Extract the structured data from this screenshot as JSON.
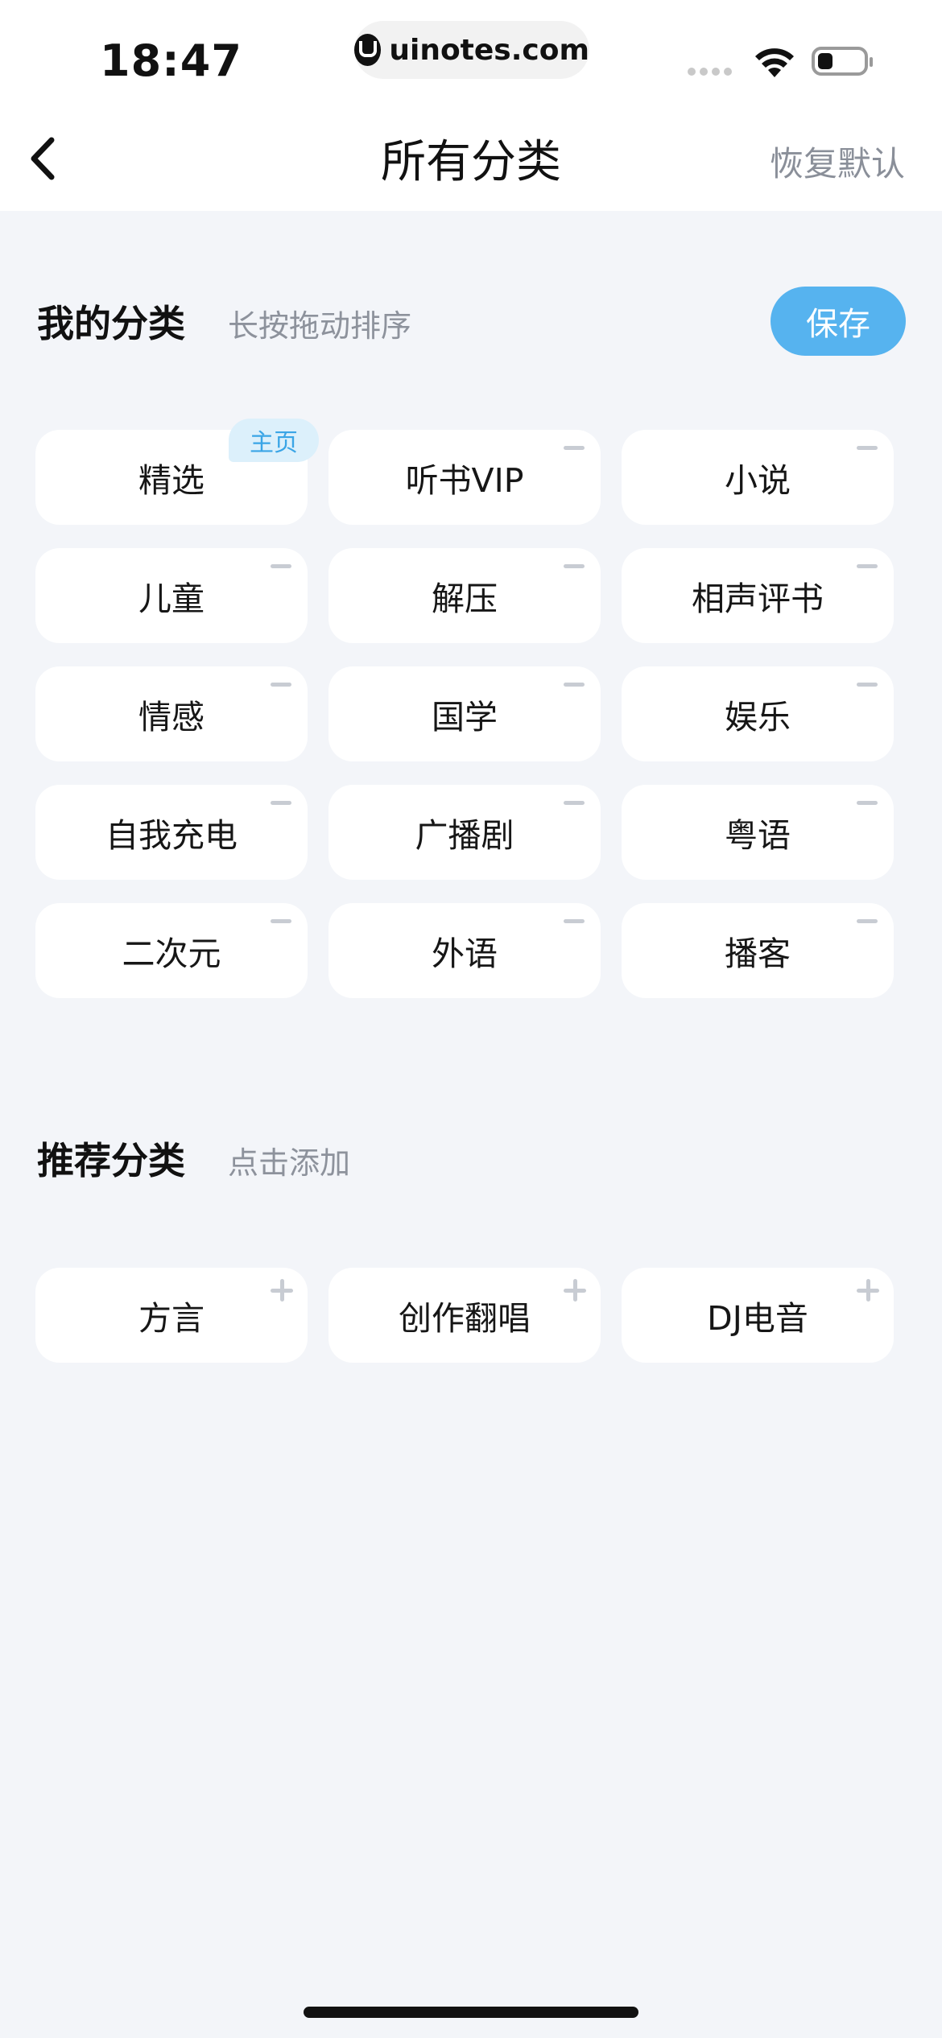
{
  "status_bar": {
    "time": "18:47",
    "url": "uinotes.com"
  },
  "header": {
    "title": "所有分类",
    "reset_label": "恢复默认"
  },
  "my_categories": {
    "title": "我的分类",
    "hint": "长按拖动排序",
    "save_label": "保存",
    "home_badge": "主页",
    "items": [
      "精选",
      "听书VIP",
      "小说",
      "儿童",
      "解压",
      "相声评书",
      "情感",
      "国学",
      "娱乐",
      "自我充电",
      "广播剧",
      "粤语",
      "二次元",
      "外语",
      "播客"
    ]
  },
  "recommended": {
    "title": "推荐分类",
    "hint": "点击添加",
    "items": [
      "方言",
      "创作翻唱",
      "DJ电音"
    ]
  },
  "colors": {
    "accent": "#56b3ef",
    "badge_bg": "#dcf0fb",
    "badge_text": "#3aa5e6",
    "background": "#f3f5f9"
  }
}
